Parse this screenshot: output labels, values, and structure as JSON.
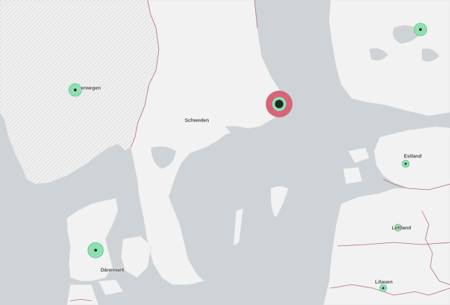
{
  "map": {
    "colors": {
      "water": "#cdd3d6",
      "land": "#f2f2f2",
      "land_relief": "#e6e6e6",
      "border": "#b8647a",
      "marker_green": "#8fe0b0",
      "marker_green_stroke": "#5fc08a",
      "marker_red": "#d96478",
      "marker_dot": "#1d2b26"
    },
    "labels": {
      "norwegen": "orwegen",
      "schweden": "Schweden",
      "daenemark": "Dänemark",
      "estland": "Estland",
      "lettland": "Lettland",
      "litauen": "Litauen"
    },
    "markers": [
      {
        "id": "oslo-region",
        "type": "green",
        "level": "small"
      },
      {
        "id": "stockholm",
        "type": "red",
        "level": "large"
      },
      {
        "id": "finland",
        "type": "green",
        "level": "small"
      },
      {
        "id": "denmark",
        "type": "green",
        "level": "medium"
      },
      {
        "id": "estonia",
        "type": "green",
        "level": "tiny"
      },
      {
        "id": "latvia",
        "type": "green",
        "level": "tiny"
      },
      {
        "id": "lithuania",
        "type": "green",
        "level": "tiny"
      }
    ]
  }
}
